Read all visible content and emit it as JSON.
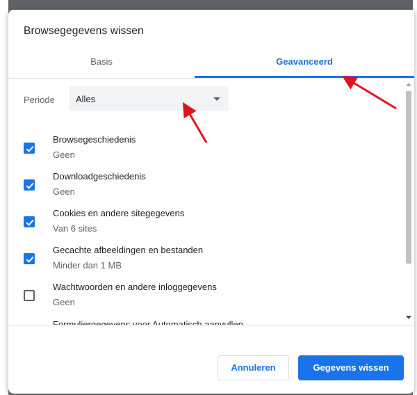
{
  "dialog": {
    "title": "Browsegegevens wissen",
    "tabs": [
      {
        "label": "Basis",
        "active": false
      },
      {
        "label": "Geavanceerd",
        "active": true
      }
    ],
    "period": {
      "label": "Periode",
      "value": "Alles"
    },
    "items": [
      {
        "label": "Browsegeschiedenis",
        "sub": "Geen",
        "checked": true
      },
      {
        "label": "Downloadgeschiedenis",
        "sub": "Geen",
        "checked": true
      },
      {
        "label": "Cookies en andere sitegegevens",
        "sub": "Van 6 sites",
        "checked": true
      },
      {
        "label": "Gecachte afbeeldingen en bestanden",
        "sub": "Minder dan 1 MB",
        "checked": true
      },
      {
        "label": "Wachtwoorden en andere inloggegevens",
        "sub": "Geen",
        "checked": false
      },
      {
        "label": "Formuliergegevens voor Automatisch aanvullen",
        "sub": "",
        "checked": false
      }
    ],
    "buttons": {
      "cancel": "Annuleren",
      "clear": "Gegevens wissen"
    }
  },
  "colors": {
    "accent": "#1a73e8",
    "annotation_arrow": "#e0141e"
  },
  "icons": [
    "check-icon",
    "dropdown-arrow-icon",
    "scroll-up-icon",
    "scroll-down-icon",
    "red-arrow-annotation"
  ]
}
